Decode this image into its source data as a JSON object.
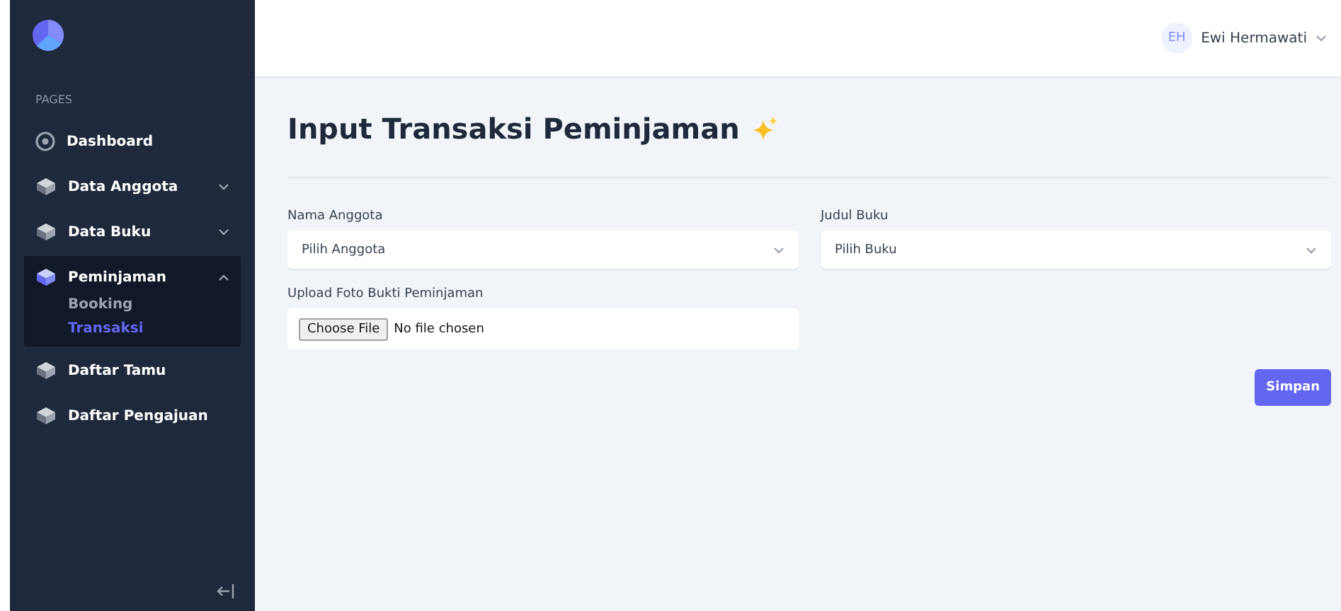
{
  "sidebar": {
    "section": "PAGES",
    "items": [
      {
        "label": "Dashboard",
        "kind": "gauge",
        "selected": false
      },
      {
        "label": "Data Anggota",
        "kind": "cube",
        "selected": false,
        "expanded": false
      },
      {
        "label": "Data Buku",
        "kind": "cube",
        "selected": false,
        "expanded": false
      },
      {
        "label": "Peminjaman",
        "kind": "cube",
        "selected": true,
        "expanded": true,
        "children": [
          {
            "label": "Booking",
            "selected": false
          },
          {
            "label": "Transaksi",
            "selected": true
          }
        ]
      },
      {
        "label": "Daftar Tamu",
        "kind": "cube",
        "selected": false
      },
      {
        "label": "Daftar Pengajuan",
        "kind": "cube",
        "selected": false
      }
    ]
  },
  "header": {
    "user": {
      "initials": "EH",
      "name": "Ewi Hermawati"
    }
  },
  "page": {
    "title": "Input Transaksi Peminjaman",
    "fields": [
      {
        "kind": "select",
        "label": "Nama Anggota",
        "value": "Pilih Anggota"
      },
      {
        "kind": "select",
        "label": "Judul Buku",
        "value": "Pilih Buku"
      },
      {
        "kind": "file",
        "label": "Upload Foto Bukti Peminjaman",
        "button": "Choose File",
        "value": "No file chosen"
      }
    ],
    "submit": "Simpan"
  }
}
